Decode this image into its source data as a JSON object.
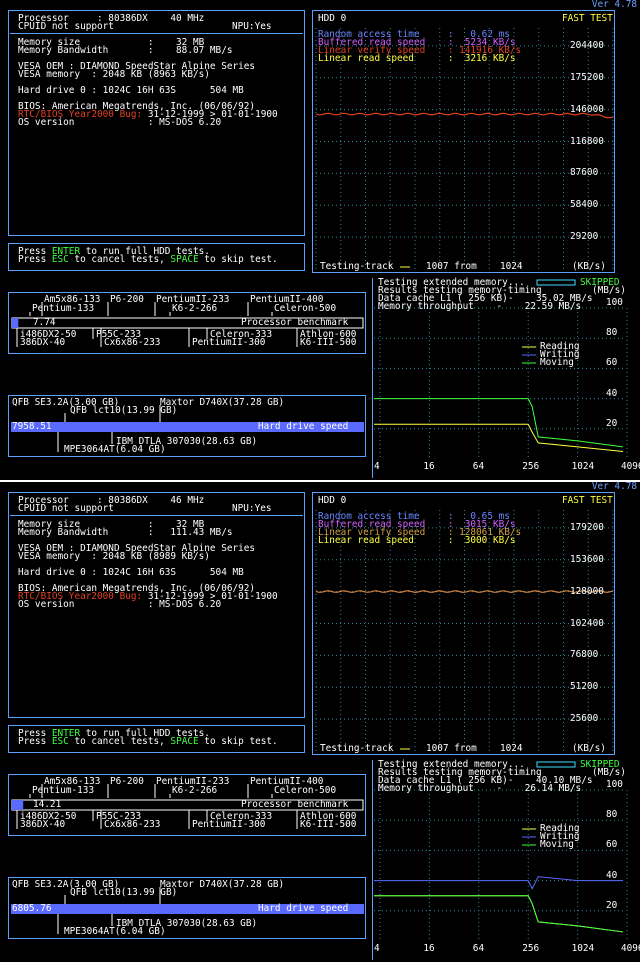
{
  "colors": {
    "frame": "#5aa0ff",
    "yellow": "#ffff40",
    "green": "#40ff40",
    "cyan": "#40e0ff",
    "red": "#e04020",
    "blue": "#6a86ff"
  },
  "chart_data": [
    {
      "type": "line",
      "title": "HDD 0",
      "xlabel": "Testing track",
      "ylabel": "(KB/s)",
      "ylim": [
        0,
        233600
      ],
      "yticks": [
        29200,
        58400,
        87600,
        116800,
        146000,
        175200,
        204400
      ],
      "series": [
        {
          "name": "Linear verify speed",
          "values": [
            141916,
            141916,
            141916,
            141916,
            141916
          ]
        }
      ]
    },
    {
      "type": "line",
      "xlabel": "",
      "ylabel": "(MB/s)",
      "xscale": "log2",
      "xticks": [
        4,
        16,
        64,
        256,
        1024,
        4096
      ],
      "yticks": [
        20,
        40,
        60,
        80,
        100
      ],
      "series": [
        {
          "name": "Reading",
          "values": [
            23,
            23,
            23,
            23,
            8,
            5
          ]
        },
        {
          "name": "Moving",
          "values": [
            40,
            40,
            40,
            40,
            12,
            8
          ]
        }
      ]
    },
    {
      "type": "line",
      "title": "HDD 0",
      "xlabel": "Testing track",
      "ylabel": "(KB/s)",
      "ylim": [
        0,
        204800
      ],
      "yticks": [
        25600,
        51200,
        76800,
        102400,
        128000,
        153600,
        179200
      ],
      "series": [
        {
          "name": "Linear verify speed",
          "values": [
            128061,
            128061,
            128061,
            128061,
            128061
          ]
        }
      ]
    },
    {
      "type": "line",
      "xlabel": "",
      "ylabel": "(MB/s)",
      "xscale": "log2",
      "xticks": [
        4,
        16,
        64,
        256,
        1024,
        4096
      ],
      "yticks": [
        20,
        40,
        60,
        80,
        100
      ],
      "series": [
        {
          "name": "Writing",
          "values": [
            40,
            40,
            40,
            40,
            40,
            40
          ]
        },
        {
          "name": "Reading",
          "values": [
            30,
            30,
            30,
            30,
            10,
            6
          ]
        },
        {
          "name": "Moving",
          "values": [
            30,
            30,
            30,
            30,
            10,
            6
          ]
        }
      ]
    }
  ],
  "screens": [
    {
      "version": "Ver 4.78",
      "sys": {
        "proc": "Processor     : 80386DX    40 MHz",
        "cpuid": "CPUID not support",
        "npu": "NPU:Yes",
        "mem": "Memory size            :    32 MB",
        "bw": "Memory Bandwidth       :    88.07 MB/s",
        "vesa": "VESA OEM : DIAMOND SpeedStar Alpine Series",
        "vmem": "VESA memory  : 2048 KB (8963 KB/s)",
        "hdd": "Hard drive 0 : 1024C 16H 63S      504 MB",
        "bios": "BIOS: American Megatrends, Inc. (06/06/92)",
        "y2k_label": "RTC/BIOS Year2000 Bug: ",
        "y2k_value": "31-12-1999 > 01-01-1900",
        "os": "OS version             : MS-DOS 6.20"
      },
      "prompt": {
        "l1a": "Press ",
        "enter": "ENTER",
        "l1b": " to run full HDD tests.",
        "l2a": "Press ",
        "esc": "ESC",
        "l2b": " to cancel tests, ",
        "space": "SPACE",
        "l2c": " to skip test."
      },
      "hdd": {
        "title": "HDD 0",
        "mode": "FAST TEST",
        "r1": "Random access time     :   0.62 ms",
        "r2": "Buffered read speed    :  5234 KB/s",
        "r3": "Linear verify speed    : 141916 KB/s",
        "r4": "Linear read speed      :  3216 KB/s",
        "ticks": [
          "204400",
          "175200",
          "146000",
          "116800",
          "87600",
          "58400",
          "29200"
        ],
        "track_a": "Testing-track",
        "track_b": "1007 from",
        "track_c": "1024",
        "unit": "(KB/s)"
      },
      "bench": {
        "top": [
          "Am5x86-133",
          "P6-200",
          "PentiumII-233",
          "PentiumII-400",
          "Pentium-133",
          "K6-2-266",
          "Celeron-500"
        ],
        "value": "7.74",
        "label": "Processor benchmark",
        "fill": 0.018,
        "bot": [
          "i486DX2-50",
          "P55C-233",
          "Celeron-333",
          "Athlon-600",
          "386DX-40",
          "Cx6x86-233",
          "PentiumII-300",
          "K6-III-500"
        ]
      },
      "disk": {
        "top": [
          "QFB SE3.2A(3.00 GB)",
          "Maxtor D740X(37.28 GB)",
          "QFB lct10(13.99 GB)"
        ],
        "value": "7958.51",
        "label": "Hard drive speed",
        "fill": 1.0,
        "bot": [
          "IBM DTLA 307030(28.63 GB)",
          "MPE3064AT(6.04 GB)"
        ]
      },
      "mem": {
        "l1": "Testing extended memory...",
        "skip": "SKIPPED",
        "l2": "Results testing memory-timing",
        "unit": "(MB/s)",
        "l3": "Data cache L1 ( 256 KB)-    35.02 MB/s",
        "l4": "Memory throughput    -    22.59 MB/s",
        "ticks": [
          "100",
          "80",
          "60",
          "40",
          "20"
        ],
        "x": [
          "4",
          "16",
          "64",
          "256",
          "1024",
          "4096"
        ],
        "leg": [
          "Reading",
          "Writing",
          "Moving"
        ]
      }
    },
    {
      "version": "Ver 4.78",
      "sys": {
        "proc": "Processor     : 80386DX    46 MHz",
        "cpuid": "CPUID not support",
        "npu": "NPU:Yes",
        "mem": "Memory size            :    32 MB",
        "bw": "Memory Bandwidth       :   111.43 MB/s",
        "vesa": "VESA OEM : DIAMOND SpeedStar Alpine Series",
        "vmem": "VESA memory  : 2048 KB (8989 KB/s)",
        "hdd": "Hard drive 0 : 1024C 16H 63S      504 MB",
        "bios": "BIOS: American Megatrends, Inc. (06/06/92)",
        "y2k_label": "RTC/BIOS Year2000 Bug: ",
        "y2k_value": "31-12-1999 > 01-01-1900",
        "os": "OS version             : MS-DOS 6.20"
      },
      "prompt": {
        "l1a": "Press ",
        "enter": "ENTER",
        "l1b": " to run full HDD tests.",
        "l2a": "Press ",
        "esc": "ESC",
        "l2b": " to cancel tests, ",
        "space": "SPACE",
        "l2c": " to skip test."
      },
      "hdd": {
        "title": "HDD 0",
        "mode": "FAST TEST",
        "r1": "Random access time     :   0.65 ms",
        "r2": "Buffered read speed    :  3015 KB/s",
        "r3": "Linear verify speed    : 128061 KB/s",
        "r4": "Linear read speed      :  3000 KB/s",
        "ticks": [
          "179200",
          "153600",
          "128000",
          "102400",
          "76800",
          "51200",
          "25600"
        ],
        "track_a": "Testing-track",
        "track_b": "1007 from",
        "track_c": "1024",
        "unit": "(KB/s)"
      },
      "bench": {
        "top": [
          "Am5x86-133",
          "P6-200",
          "PentiumII-233",
          "PentiumII-400",
          "Pentium-133",
          "K6-2-266",
          "Celeron-500"
        ],
        "value": "14.21",
        "label": "Processor benchmark",
        "fill": 0.032,
        "bot": [
          "i486DX2-50",
          "P55C-233",
          "Celeron-333",
          "Athlon-600",
          "386DX-40",
          "Cx6x86-233",
          "PentiumII-300",
          "K6-III-500"
        ]
      },
      "disk": {
        "top": [
          "QFB SE3.2A(3.00 GB)",
          "Maxtor D740X(37.28 GB)",
          "QFB lct10(13.99 GB)"
        ],
        "value": "6805.76",
        "label": "Hard drive speed",
        "fill": 1.0,
        "bot": [
          "IBM DTLA 307030(28.63 GB)",
          "MPE3064AT(6.04 GB)"
        ]
      },
      "mem": {
        "l1": "Testing extended memory...",
        "skip": "SKIPPED",
        "l2": "Results testing memory-timing",
        "unit": "(MB/s)",
        "l3": "Data cache L1 ( 256 KB)-    40.10 MB/s",
        "l4": "Memory throughput    -    26.14 MB/s",
        "ticks": [
          "100",
          "80",
          "60",
          "40",
          "20"
        ],
        "x": [
          "4",
          "16",
          "64",
          "256",
          "1024",
          "4096"
        ],
        "leg": [
          "Reading",
          "Writing",
          "Moving"
        ]
      }
    }
  ]
}
